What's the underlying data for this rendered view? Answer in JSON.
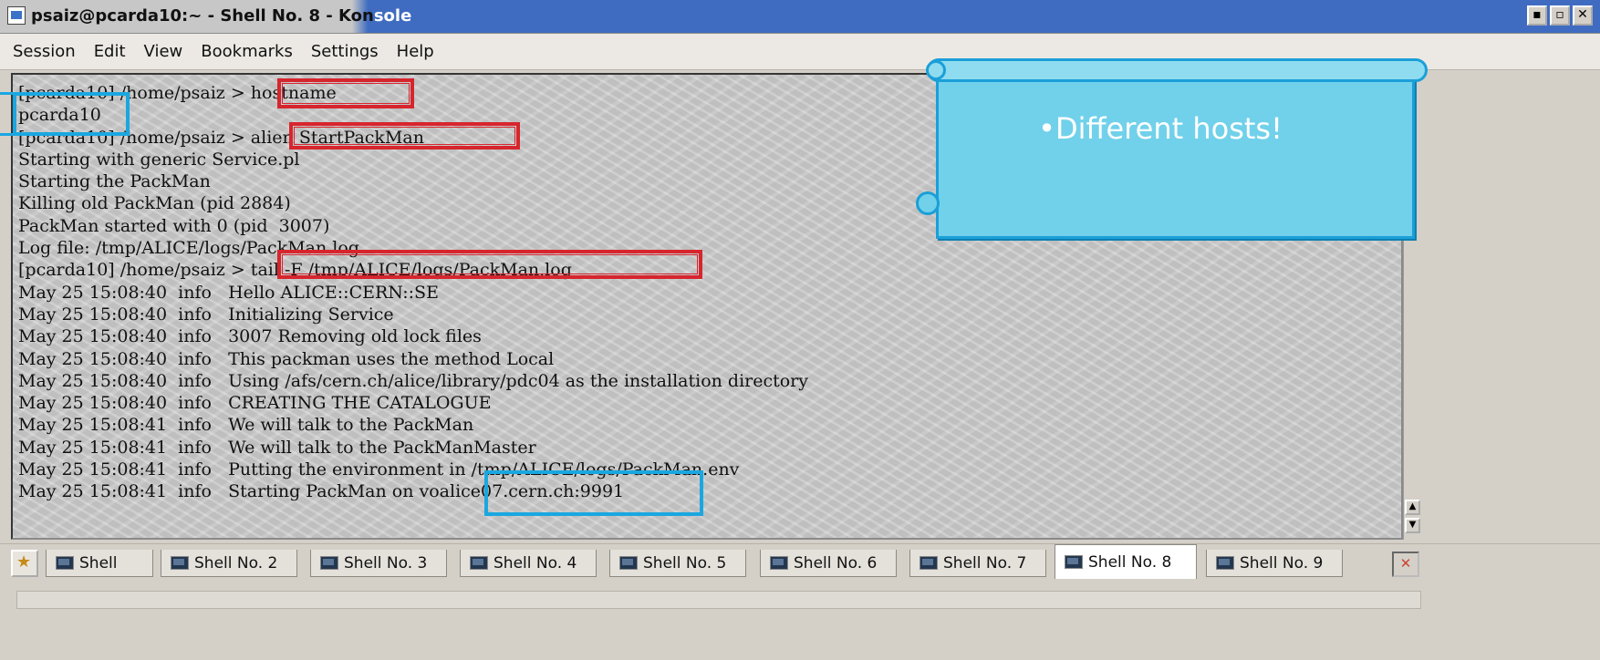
{
  "window": {
    "title_prefix": "psaiz@pcarda10:~ - Shell No. 8 - Kon",
    "title_suffix": "sole",
    "buttons": [
      "▪",
      "▫",
      "✕"
    ]
  },
  "menu": [
    "Session",
    "Edit",
    "View",
    "Bookmarks",
    "Settings",
    "Help"
  ],
  "terminal": {
    "lines": [
      "[pcarda10] /home/psaiz > hostname",
      "pcarda10",
      "[pcarda10] /home/psaiz > alien StartPackMan",
      "Starting with generic Service.pl",
      "Starting the PackMan",
      "Killing old PackMan (pid 2884)",
      "PackMan started with 0 (pid  3007)",
      "Log file: /tmp/ALICE/logs/PackMan.log",
      "[pcarda10] /home/psaiz > tail -F /tmp/ALICE/logs/PackMan.log",
      "May 25 15:08:40  info   Hello ALICE::CERN::SE",
      "May 25 15:08:40  info   Initializing Service",
      "May 25 15:08:40  info   3007 Removing old lock files",
      "May 25 15:08:40  info   This packman uses the method Local",
      "May 25 15:08:40  info   Using /afs/cern.ch/alice/library/pdc04 as the installation directory",
      "May 25 15:08:40  info   CREATING THE CATALOGUE",
      "May 25 15:08:41  info   We will talk to the PackMan",
      "May 25 15:08:41  info   We will talk to the PackManMaster",
      "May 25 15:08:41  info   Putting the environment in /tmp/ALICE/logs/PackMan.env",
      "May 25 15:08:41  info   Starting PackMan on voalice07.cern.ch:9991"
    ]
  },
  "callout": {
    "text": "•Different hosts!"
  },
  "tabs": [
    "Shell",
    "Shell No. 2",
    "Shell No. 3",
    "Shell No. 4",
    "Shell No. 5",
    "Shell No. 6",
    "Shell No. 7",
    "Shell No. 8",
    "Shell No. 9"
  ],
  "active_tab": "Shell No. 8",
  "colors": {
    "highlight_red": "#d7252d",
    "highlight_blue": "#1aa7e0",
    "callout_fill": "#71d1ea",
    "titlebar_active": "#3f6cc0"
  },
  "icons": {
    "window": "konsole-icon",
    "new_session": "new-session-icon",
    "tab": "terminal-icon",
    "close_session": "close-session-icon",
    "scroll_up": "arrow-up-icon",
    "scroll_down": "arrow-down-icon"
  }
}
